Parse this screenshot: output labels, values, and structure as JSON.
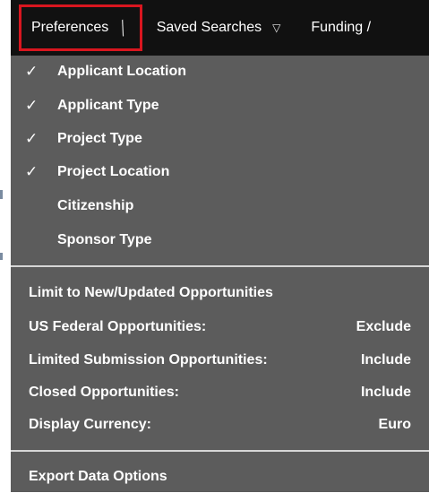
{
  "menubar": {
    "items": [
      {
        "label": "Preferences",
        "active": true
      },
      {
        "label": "Saved Searches"
      },
      {
        "label": "Funding /"
      }
    ]
  },
  "preferences": [
    {
      "label": "Applicant Location",
      "checked": true
    },
    {
      "label": "Applicant Type",
      "checked": true
    },
    {
      "label": "Project Type",
      "checked": true
    },
    {
      "label": "Project Location",
      "checked": true
    },
    {
      "label": "Citizenship",
      "checked": false
    },
    {
      "label": "Sponsor Type",
      "checked": false
    }
  ],
  "check_glyph": "✓",
  "options": {
    "limit_label": "Limit to New/Updated Opportunities",
    "rows": [
      {
        "label": "US Federal Opportunities:",
        "value": "Exclude"
      },
      {
        "label": "Limited Submission Opportunities:",
        "value": "Include"
      },
      {
        "label": "Closed Opportunities:",
        "value": "Include"
      },
      {
        "label": "Display Currency:",
        "value": "Euro"
      }
    ]
  },
  "export": {
    "label": "Export Data Options"
  },
  "colors": {
    "menubar": "#111111",
    "dropdown": "#5c5c5c",
    "highlight_border": "#d9161f",
    "divider": "#d6d6d6"
  }
}
